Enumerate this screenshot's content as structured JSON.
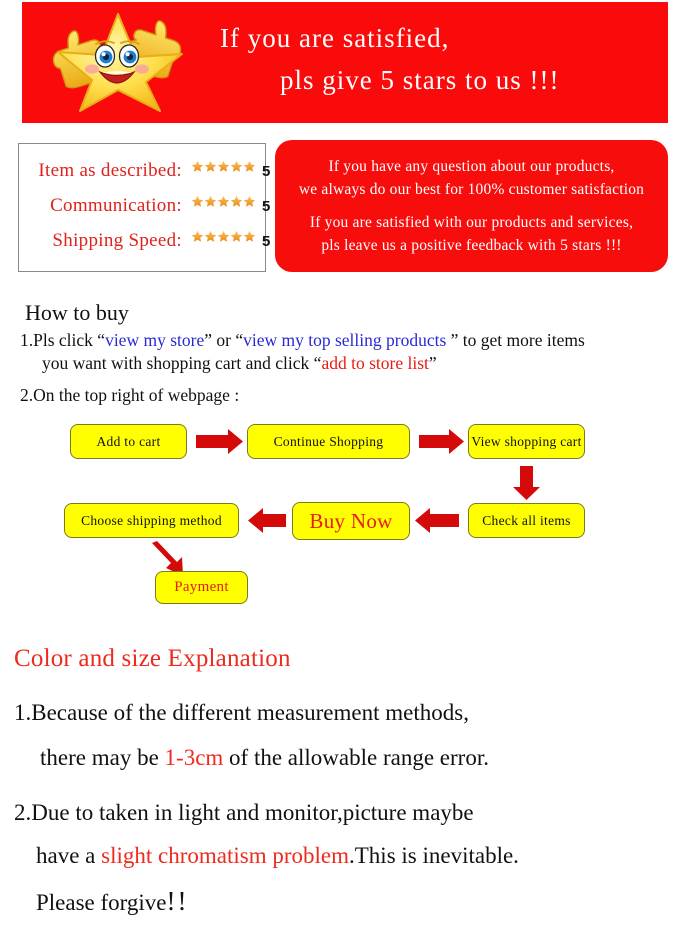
{
  "banner": {
    "line1": "If you are satisfied,",
    "line2": "pls give 5 stars to us !!!",
    "background_color": "#fa0a0a",
    "text_color": "#ffffff",
    "mascot_icon": "smiling-star-thumbs-up-icon"
  },
  "ratings": {
    "label_color": "#e0221b",
    "star_color": "#f0932b",
    "rows": [
      {
        "label": "Item as described:",
        "stars": 5,
        "value": "5"
      },
      {
        "label": "Communication:",
        "stars": 5,
        "value": "5"
      },
      {
        "label": "Shipping Speed:",
        "stars": 5,
        "value": "5"
      }
    ]
  },
  "feedback": {
    "background_color": "#f80d0d",
    "text_color": "#ffffff",
    "lines": [
      "If you have any question about our products,",
      "we always do our best for 100% customer satisfaction",
      "If you are satisfied with our products and services,",
      "pls leave us a positive feedback with 5 stars !!!"
    ]
  },
  "how_to_buy": {
    "title": "How to buy",
    "step1": {
      "prefix": "1.Pls click “",
      "link1": "view my store",
      "middle": "” or “",
      "link2": "view my top selling products",
      "suffix": " ” to get more items",
      "line2_prefix": "you want with shopping cart and click “",
      "line2_link": "add to store list",
      "line2_suffix": "”",
      "link_color": "#2a2ad4",
      "accent_color": "#e81c12"
    },
    "step2": "2.On the top right of webpage :"
  },
  "flowchart": {
    "box_fill": "#ffff00",
    "box_border": "#7a7a1e",
    "arrow_color": "#d40a0a",
    "boxes": [
      {
        "id": "add-to-cart",
        "label": "Add to cart"
      },
      {
        "id": "continue-shopping",
        "label": "Continue Shopping"
      },
      {
        "id": "view-cart",
        "label": "View shopping cart"
      },
      {
        "id": "check-items",
        "label": "Check all items"
      },
      {
        "id": "buy-now",
        "label": "Buy Now"
      },
      {
        "id": "choose-shipping",
        "label": "Choose shipping method"
      },
      {
        "id": "payment",
        "label": "Payment"
      }
    ]
  },
  "color_size": {
    "title": "Color and size Explanation",
    "title_color": "#ee2a1e",
    "item1_line1": "1.Because of the different measurement methods,",
    "item1_line2_pre": "there may be ",
    "item1_highlight": "1-3cm",
    "item1_line2_post": " of the allowable range error.",
    "item2_line1": "2.Due to taken in light and monitor,picture maybe",
    "item2_line2_pre": "have a ",
    "item2_highlight": "slight chromatism problem",
    "item2_line2_post": ".This is inevitable.",
    "item2_line3": "Please forgive",
    "item2_bangs": "!!"
  }
}
